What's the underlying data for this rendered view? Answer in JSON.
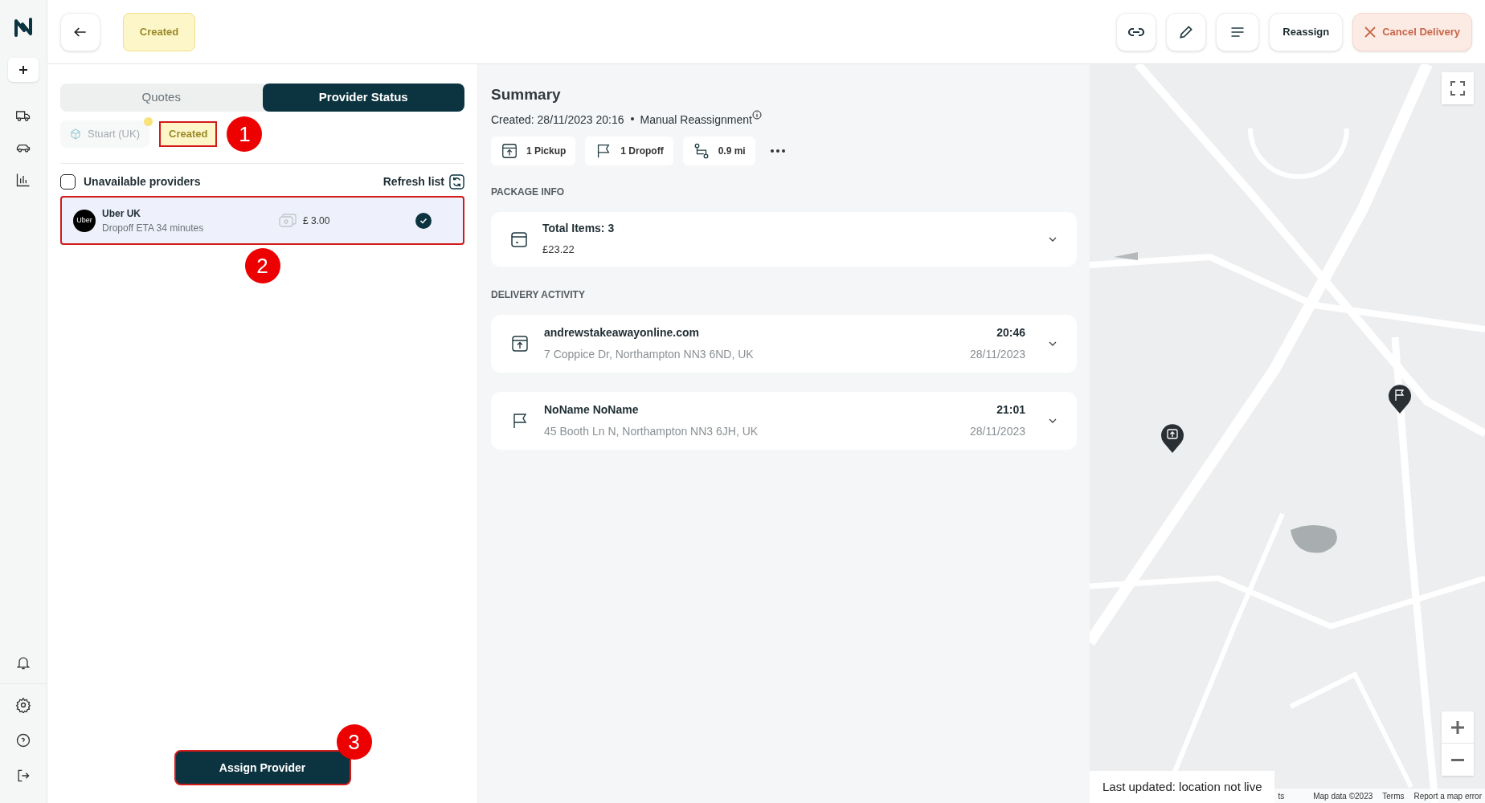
{
  "header": {
    "status_badge": "Created",
    "reassign": "Reassign",
    "cancel": "Cancel Delivery"
  },
  "tabs": [
    {
      "label": "Quotes",
      "selected": false
    },
    {
      "label": "Provider Status",
      "selected": true
    }
  ],
  "provider_status": {
    "provider": "Stuart (UK)",
    "status": "Created"
  },
  "unavailable_providers": {
    "label": "Unavailable providers",
    "checked": false
  },
  "refresh": "Refresh list",
  "providers": [
    {
      "logo": "Uber",
      "name": "Uber UK",
      "eta": "Dropoff ETA 34 minutes",
      "price": "£ 3.00",
      "selected": true
    }
  ],
  "assign_button": "Assign Provider",
  "annotations": [
    "1",
    "2",
    "3"
  ],
  "summary": {
    "title": "Summary",
    "created": "Created: 28/11/2023 20:16",
    "reason": "Manual Reassignment",
    "chips": [
      {
        "kind": "pickup",
        "label": "1 Pickup"
      },
      {
        "kind": "dropoff",
        "label": "1 Dropoff"
      },
      {
        "kind": "distance",
        "label": "0.9 mi"
      }
    ]
  },
  "package_info": {
    "heading": "PACKAGE INFO",
    "title": "Total Items: 3",
    "value": "£23.22"
  },
  "delivery_activity": {
    "heading": "DELIVERY ACTIVITY",
    "stops": [
      {
        "kind": "pickup",
        "name": "andrewstakeawayonline.com",
        "address": "7 Coppice Dr, Northampton NN3 6ND, UK",
        "time": "20:46",
        "date": "28/11/2023"
      },
      {
        "kind": "dropoff",
        "name": "NoName NoName",
        "address": "45 Booth Ln N, Northampton NN3 6JH, UK",
        "time": "21:01",
        "date": "28/11/2023"
      }
    ]
  },
  "map": {
    "status": "Last updated: location not live",
    "attribution": [
      "ts",
      "Map data ©2023",
      "Terms",
      "Report a map error"
    ]
  }
}
